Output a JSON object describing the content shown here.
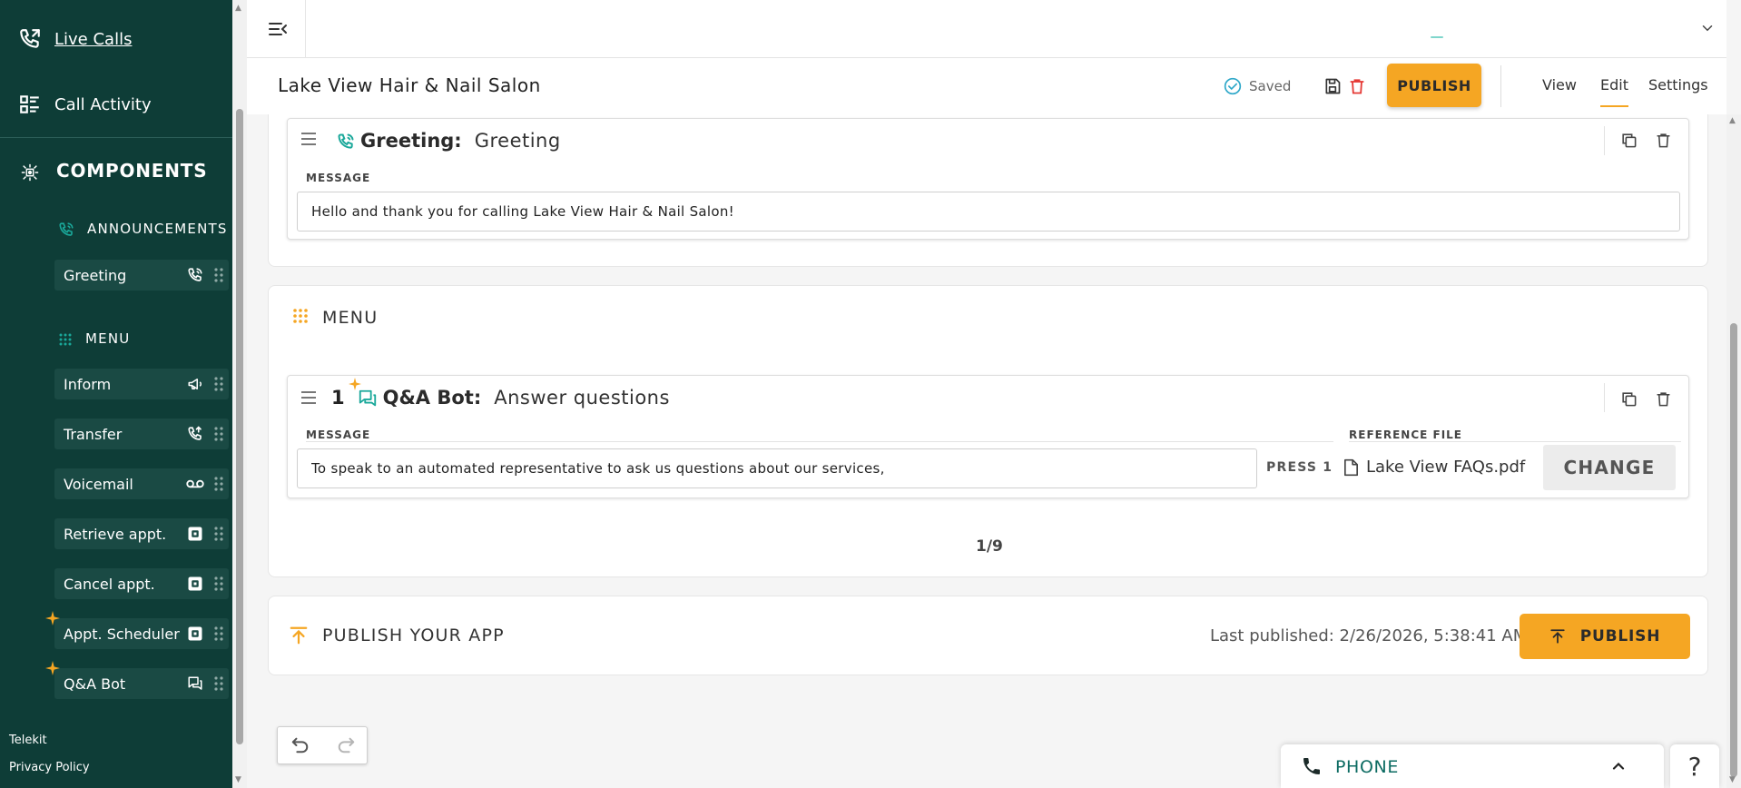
{
  "sidebar": {
    "live_calls": "Live Calls",
    "call_activity": "Call Activity",
    "components_title": "COMPONENTS",
    "groups": {
      "announcements": "ANNOUNCEMENTS",
      "menu": "MENU"
    },
    "items": [
      {
        "label": "Greeting",
        "icon": "phone-call-icon"
      },
      {
        "label": "Inform",
        "icon": "megaphone-icon"
      },
      {
        "label": "Transfer",
        "icon": "phone-transfer-icon"
      },
      {
        "label": "Voicemail",
        "icon": "voicemail-icon"
      },
      {
        "label": "Retrieve appt.",
        "icon": "square-app-icon"
      },
      {
        "label": "Cancel appt.",
        "icon": "square-app-icon"
      },
      {
        "label": "Appt. Scheduler",
        "icon": "square-app-icon"
      },
      {
        "label": "Q&A Bot",
        "icon": "chat-icon"
      }
    ],
    "footer": {
      "company": "Telekit",
      "privacy": "Privacy Policy"
    }
  },
  "header": {
    "app_title": "Lake View Hair & Nail Salon",
    "saved_label": "Saved",
    "publish_label": "PUBLISH",
    "tabs": [
      "View",
      "Edit",
      "Settings"
    ],
    "active_tab": "Edit"
  },
  "greeting": {
    "type_label": "Greeting:",
    "name": "Greeting",
    "message_label": "MESSAGE",
    "message": "Hello and thank you for calling Lake View Hair & Nail Salon!"
  },
  "menu": {
    "title": "MENU",
    "option": {
      "number": "1",
      "type_label": "Q&A Bot:",
      "name": "Answer questions",
      "message_label": "MESSAGE",
      "message": "To speak to an automated representative to ask us questions about our services,",
      "press_label": "PRESS 1",
      "reference_label": "REFERENCE FILE",
      "reference_file": "Lake View FAQs.pdf",
      "change_label": "CHANGE"
    },
    "pager": "1/9"
  },
  "publish_section": {
    "title": "PUBLISH YOUR APP",
    "last_published": "Last published: 2/26/2026, 5:38:41 AM",
    "button_label": "PUBLISH"
  },
  "phone_widget": {
    "label": "PHONE"
  },
  "help_label": "?",
  "colors": {
    "sidebar_bg": "#0e3d37",
    "accent_orange": "#f5a623",
    "teal": "#1aa89a"
  }
}
